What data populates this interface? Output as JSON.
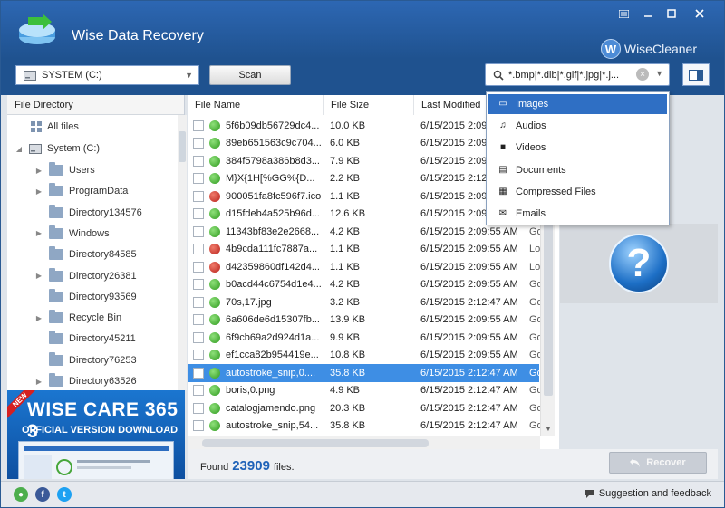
{
  "window": {
    "title": "Wise Data Recovery",
    "brand": "WiseCleaner",
    "brand_badge": "W"
  },
  "toolbar": {
    "drive": "SYSTEM (C:)",
    "scan_label": "Scan",
    "filter_value": "*.bmp|*.dib|*.gif|*.jpg|*.j..."
  },
  "left_panel": {
    "header": "File Directory",
    "all_files": "All files",
    "drive": "System (C:)",
    "folders": [
      "Users",
      "ProgramData",
      "Directory134576",
      "Windows",
      "Directory84585",
      "Directory26381",
      "Directory93569",
      "Recycle Bin",
      "Directory45211",
      "Directory76253",
      "Directory63526"
    ]
  },
  "ad": {
    "badge": "NEW",
    "title": "WISE CARE 365 3",
    "subtitle": "OFFICIAL VERSION DOWNLOAD"
  },
  "file_list": {
    "columns": [
      "File Name",
      "File Size",
      "Last Modified"
    ],
    "rows": [
      {
        "name": "5f6b09db56729dc4...",
        "size": "10.0 KB",
        "date": "6/15/2015 2:09",
        "state": "",
        "status": "good"
      },
      {
        "name": "89eb651563c9c704...",
        "size": "6.0 KB",
        "date": "6/15/2015 2:09",
        "state": "",
        "status": "good"
      },
      {
        "name": "384f5798a386b8d3...",
        "size": "7.9 KB",
        "date": "6/15/2015 2:09",
        "state": "",
        "status": "good"
      },
      {
        "name": "M}X{1H[%GG%{D...",
        "size": "2.2 KB",
        "date": "6/15/2015 2:12",
        "state": "",
        "status": "good"
      },
      {
        "name": "900051fa8fc596f7.ico",
        "size": "1.1 KB",
        "date": "6/15/2015 2:09",
        "state": "",
        "status": "lost"
      },
      {
        "name": "d15fdeb4a525b96d...",
        "size": "12.6 KB",
        "date": "6/15/2015 2:09",
        "state": "",
        "status": "good"
      },
      {
        "name": "11343bf83e2e2668...",
        "size": "4.2 KB",
        "date": "6/15/2015 2:09:55 AM",
        "state": "Go",
        "status": "good"
      },
      {
        "name": "4b9cda111fc7887a...",
        "size": "1.1 KB",
        "date": "6/15/2015 2:09:55 AM",
        "state": "Los",
        "status": "lost"
      },
      {
        "name": "d42359860df142d4...",
        "size": "1.1 KB",
        "date": "6/15/2015 2:09:55 AM",
        "state": "Los",
        "status": "lost"
      },
      {
        "name": "b0acd44c6754d1e4...",
        "size": "4.2 KB",
        "date": "6/15/2015 2:09:55 AM",
        "state": "Go",
        "status": "good"
      },
      {
        "name": "70s,17.jpg",
        "size": "3.2 KB",
        "date": "6/15/2015 2:12:47 AM",
        "state": "Go",
        "status": "good"
      },
      {
        "name": "6a606de6d15307fb...",
        "size": "13.9 KB",
        "date": "6/15/2015 2:09:55 AM",
        "state": "Go",
        "status": "good"
      },
      {
        "name": "6f9cb69a2d924d1a...",
        "size": "9.9 KB",
        "date": "6/15/2015 2:09:55 AM",
        "state": "Go",
        "status": "good"
      },
      {
        "name": "ef1cca82b954419e...",
        "size": "10.8 KB",
        "date": "6/15/2015 2:09:55 AM",
        "state": "Go",
        "status": "good"
      },
      {
        "name": "autostroke_snip,0....",
        "size": "35.8 KB",
        "date": "6/15/2015 2:12:47 AM",
        "state": "Go",
        "status": "good",
        "selected": true
      },
      {
        "name": "boris,0.png",
        "size": "4.9 KB",
        "date": "6/15/2015 2:12:47 AM",
        "state": "Go",
        "status": "good"
      },
      {
        "name": "catalogjamendo.png",
        "size": "20.3 KB",
        "date": "6/15/2015 2:12:47 AM",
        "state": "Go",
        "status": "good"
      },
      {
        "name": "autostroke_snip,54...",
        "size": "35.8 KB",
        "date": "6/15/2015 2:12:47 AM",
        "state": "Go",
        "status": "good"
      }
    ]
  },
  "dropdown": {
    "items": [
      {
        "label": "Images",
        "icon": "image-icon",
        "active": true
      },
      {
        "label": "Audios",
        "icon": "music-note-icon"
      },
      {
        "label": "Videos",
        "icon": "video-camera-icon"
      },
      {
        "label": "Documents",
        "icon": "document-icon"
      },
      {
        "label": "Compressed Files",
        "icon": "archive-icon"
      },
      {
        "label": "Emails",
        "icon": "email-icon"
      }
    ]
  },
  "footer": {
    "found_prefix": "Found",
    "found_count": "23909",
    "found_suffix": "files.",
    "recover_label": "Recover",
    "feedback": "Suggestion and feedback"
  },
  "colors": {
    "header": "#2d67b3",
    "selection": "#3e8ee4",
    "good": "#2f9a1e",
    "lost": "#b8231c"
  }
}
